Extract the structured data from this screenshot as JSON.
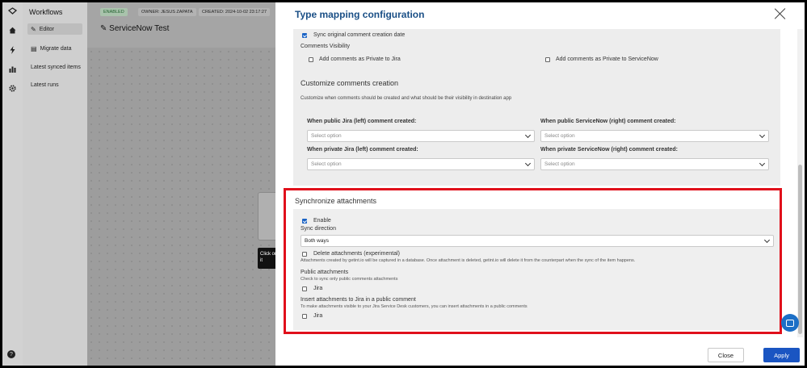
{
  "app": {
    "sidebar_title": "Workflows",
    "nav": [
      {
        "label": "Editor",
        "icon": "pencil-icon"
      },
      {
        "label": "Migrate data",
        "icon": "migrate-icon"
      },
      {
        "label": "Latest synced items",
        "icon": ""
      },
      {
        "label": "Latest runs",
        "icon": ""
      }
    ],
    "chips": {
      "status": "ENABLED",
      "owner": "OWNER: JESUS ZAPATA",
      "created": "CREATED: 2024-10-02 23:17:27"
    },
    "workflow_name": "ServiceNow Test",
    "tooltip": "Click on it",
    "rail_icons": [
      "logo-icon",
      "home-icon",
      "bolt-icon",
      "chart-icon",
      "gear-icon",
      "help-icon"
    ]
  },
  "modal": {
    "title": "Type mapping configuration",
    "sync_original_date": "Sync original comment creation date",
    "comments_visibility": "Comments Visibility",
    "private_jira": "Add comments as Private to Jira",
    "private_servicenow": "Add comments as Private to ServiceNow",
    "customize_title": "Customize comments creation",
    "customize_desc": "Customize when comments should be created and what should be their visibility in destination app",
    "public_jira_label": "When public Jira (left) comment created:",
    "public_sn_label": "When public ServiceNow (right) comment created:",
    "private_jira_label": "When private Jira (left) comment created:",
    "private_sn_label": "When private ServiceNow (right) comment created:",
    "select_placeholder": "Select option",
    "attachments": {
      "title": "Synchronize attachments",
      "enable": "Enable",
      "sync_direction": "Sync direction",
      "direction_value": "Both ways",
      "delete_label": "Delete attachments (experimental)",
      "delete_desc": "Attachments created by getint.io will be captured in a database. Once attachment is deleted, getint.io will delete it from the counterpart when the sync of the item happens.",
      "public_title": "Public attachments",
      "public_desc": "Check to sync only public comments attachments",
      "public_jira": "Jira",
      "insert_title": "Insert attachments to Jira in a public comment",
      "insert_desc": "To make attachments visible to your Jira Service Desk customers, you can insert attachments in a public comments",
      "insert_jira": "Jira"
    },
    "close_label": "Close",
    "apply_label": "Apply"
  },
  "colors": {
    "accent": "#1a55c2",
    "title": "#1a4f86",
    "highlight": "#e0101b"
  }
}
